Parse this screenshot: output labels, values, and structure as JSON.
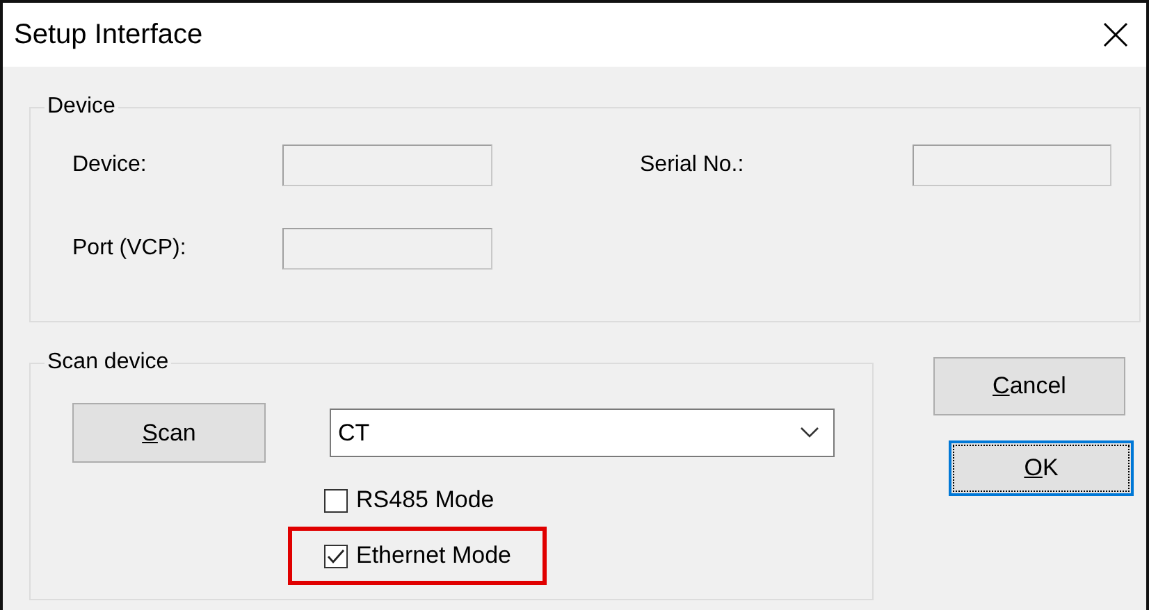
{
  "window": {
    "title": "Setup Interface"
  },
  "device_group": {
    "legend": "Device",
    "fields": [
      {
        "label": "Device:"
      },
      {
        "label": "Serial No.:"
      },
      {
        "label": "Port (VCP):"
      }
    ]
  },
  "scan_group": {
    "legend": "Scan device",
    "scan_button": {
      "label": "Scan",
      "mnemonic_underlined": true
    },
    "device_type": {
      "value": "CT"
    },
    "options": [
      {
        "label": "RS485 Mode",
        "checked": false,
        "highlighted": false
      },
      {
        "label": "Ethernet Mode",
        "checked": true,
        "highlighted": true
      }
    ]
  },
  "buttons": [
    {
      "label": "Cancel",
      "mnemonic_underlined": true,
      "focused": false
    },
    {
      "label": "OK",
      "mnemonic_underlined": true,
      "focused": true
    }
  ]
}
